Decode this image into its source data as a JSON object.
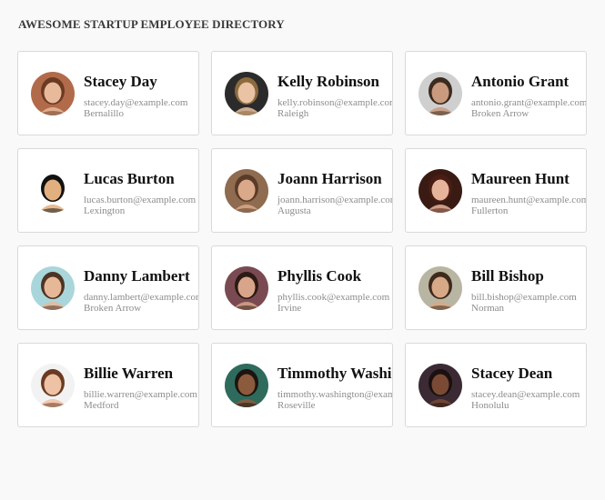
{
  "page": {
    "title": "AWESOME STARTUP EMPLOYEE DIRECTORY"
  },
  "employees": [
    {
      "name": "Stacey Day",
      "email": "stacey.day@example.com",
      "city": "Bernalillo",
      "skin": "#e8b99a",
      "hair": "#6b3a22",
      "bg": "#b26b4a"
    },
    {
      "name": "Kelly Robinson",
      "email": "kelly.robinson@example.com",
      "city": "Raleigh",
      "skin": "#e9c3a3",
      "hair": "#8c6a3e",
      "bg": "#2b2b2b"
    },
    {
      "name": "Antonio Grant",
      "email": "antonio.grant@example.com",
      "city": "Broken Arrow",
      "skin": "#c99a7e",
      "hair": "#3b2a1f",
      "bg": "#cfcfcf"
    },
    {
      "name": "Lucas Burton",
      "email": "lucas.burton@example.com",
      "city": "Lexington",
      "skin": "#e2b07f",
      "hair": "#111111",
      "bg": "#ffffff"
    },
    {
      "name": "Joann Harrison",
      "email": "joann.harrison@example.com",
      "city": "Augusta",
      "skin": "#d9a98a",
      "hair": "#5a3b28",
      "bg": "#8f6b4f"
    },
    {
      "name": "Maureen Hunt",
      "email": "maureen.hunt@example.com",
      "city": "Fullerton",
      "skin": "#e6b49b",
      "hair": "#4a1d14",
      "bg": "#3a1b14"
    },
    {
      "name": "Danny Lambert",
      "email": "danny.lambert@example.com",
      "city": "Broken Arrow",
      "skin": "#e7b898",
      "hair": "#4d3324",
      "bg": "#a9d6da"
    },
    {
      "name": "Phyllis Cook",
      "email": "phyllis.cook@example.com",
      "city": "Irvine",
      "skin": "#d8a58a",
      "hair": "#2c1a14",
      "bg": "#7a4a52"
    },
    {
      "name": "Bill Bishop",
      "email": "bill.bishop@example.com",
      "city": "Norman",
      "skin": "#d7a987",
      "hair": "#3e2a1d",
      "bg": "#b9b5a3"
    },
    {
      "name": "Billie Warren",
      "email": "billie.warren@example.com",
      "city": "Medford",
      "skin": "#eec2a4",
      "hair": "#6b3a22",
      "bg": "#f2f2f2"
    },
    {
      "name": "Timmothy Washington",
      "email": "timmothy.washington@example.com",
      "city": "Roseville",
      "skin": "#8c5a3c",
      "hair": "#1c1410",
      "bg": "#2e6b5c"
    },
    {
      "name": "Stacey Dean",
      "email": "stacey.dean@example.com",
      "city": "Honolulu",
      "skin": "#7a4a34",
      "hair": "#1a1010",
      "bg": "#3b2a34"
    }
  ]
}
